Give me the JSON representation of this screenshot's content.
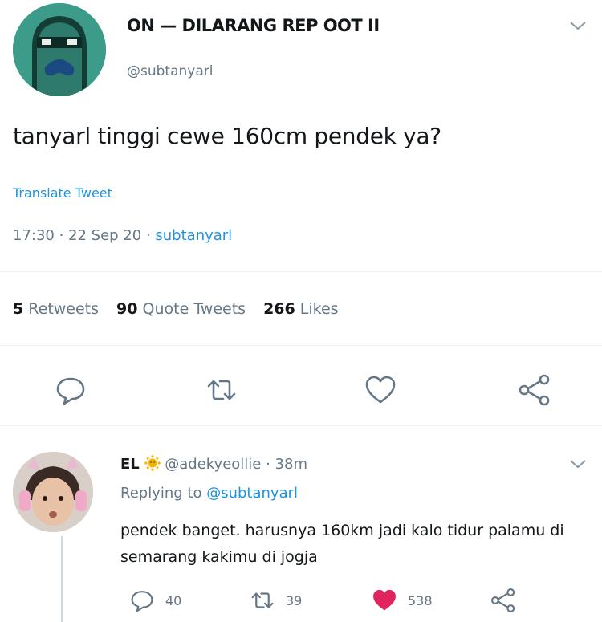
{
  "tweet": {
    "display_name": "ON — DILARANG REP OOT II",
    "username": "@subtanyarl",
    "text": "tanyarl tinggi cewe 160cm pendek ya?",
    "translate_label": "Translate Tweet",
    "time": "17:30 · 22 Sep 20 · ",
    "source": "subtanyarl",
    "stats": {
      "retweets_count": "5",
      "retweets_label": "Retweets",
      "quotes_count": "90",
      "quotes_label": "Quote Tweets",
      "likes_count": "266",
      "likes_label": "Likes"
    },
    "actions": [
      "reply-icon",
      "retweet-icon",
      "like-icon",
      "share-icon"
    ]
  },
  "reply": {
    "display_name": "EL",
    "handle": "@adekyeollie",
    "age": "· 38m",
    "replying_prefix": "Replying to ",
    "replying_to": "@subtanyarl",
    "text": "pendek banget. harusnya 160km jadi kalo tidur palamu di semarang kakimu di jogja",
    "reply_count": "40",
    "retweet_count": "39",
    "like_count": "538",
    "liked": true
  },
  "colors": {
    "link": "#1b95e0",
    "muted": "#657786",
    "like_active": "#e0245e",
    "avatar_main_bg": "#3d9b8a"
  }
}
